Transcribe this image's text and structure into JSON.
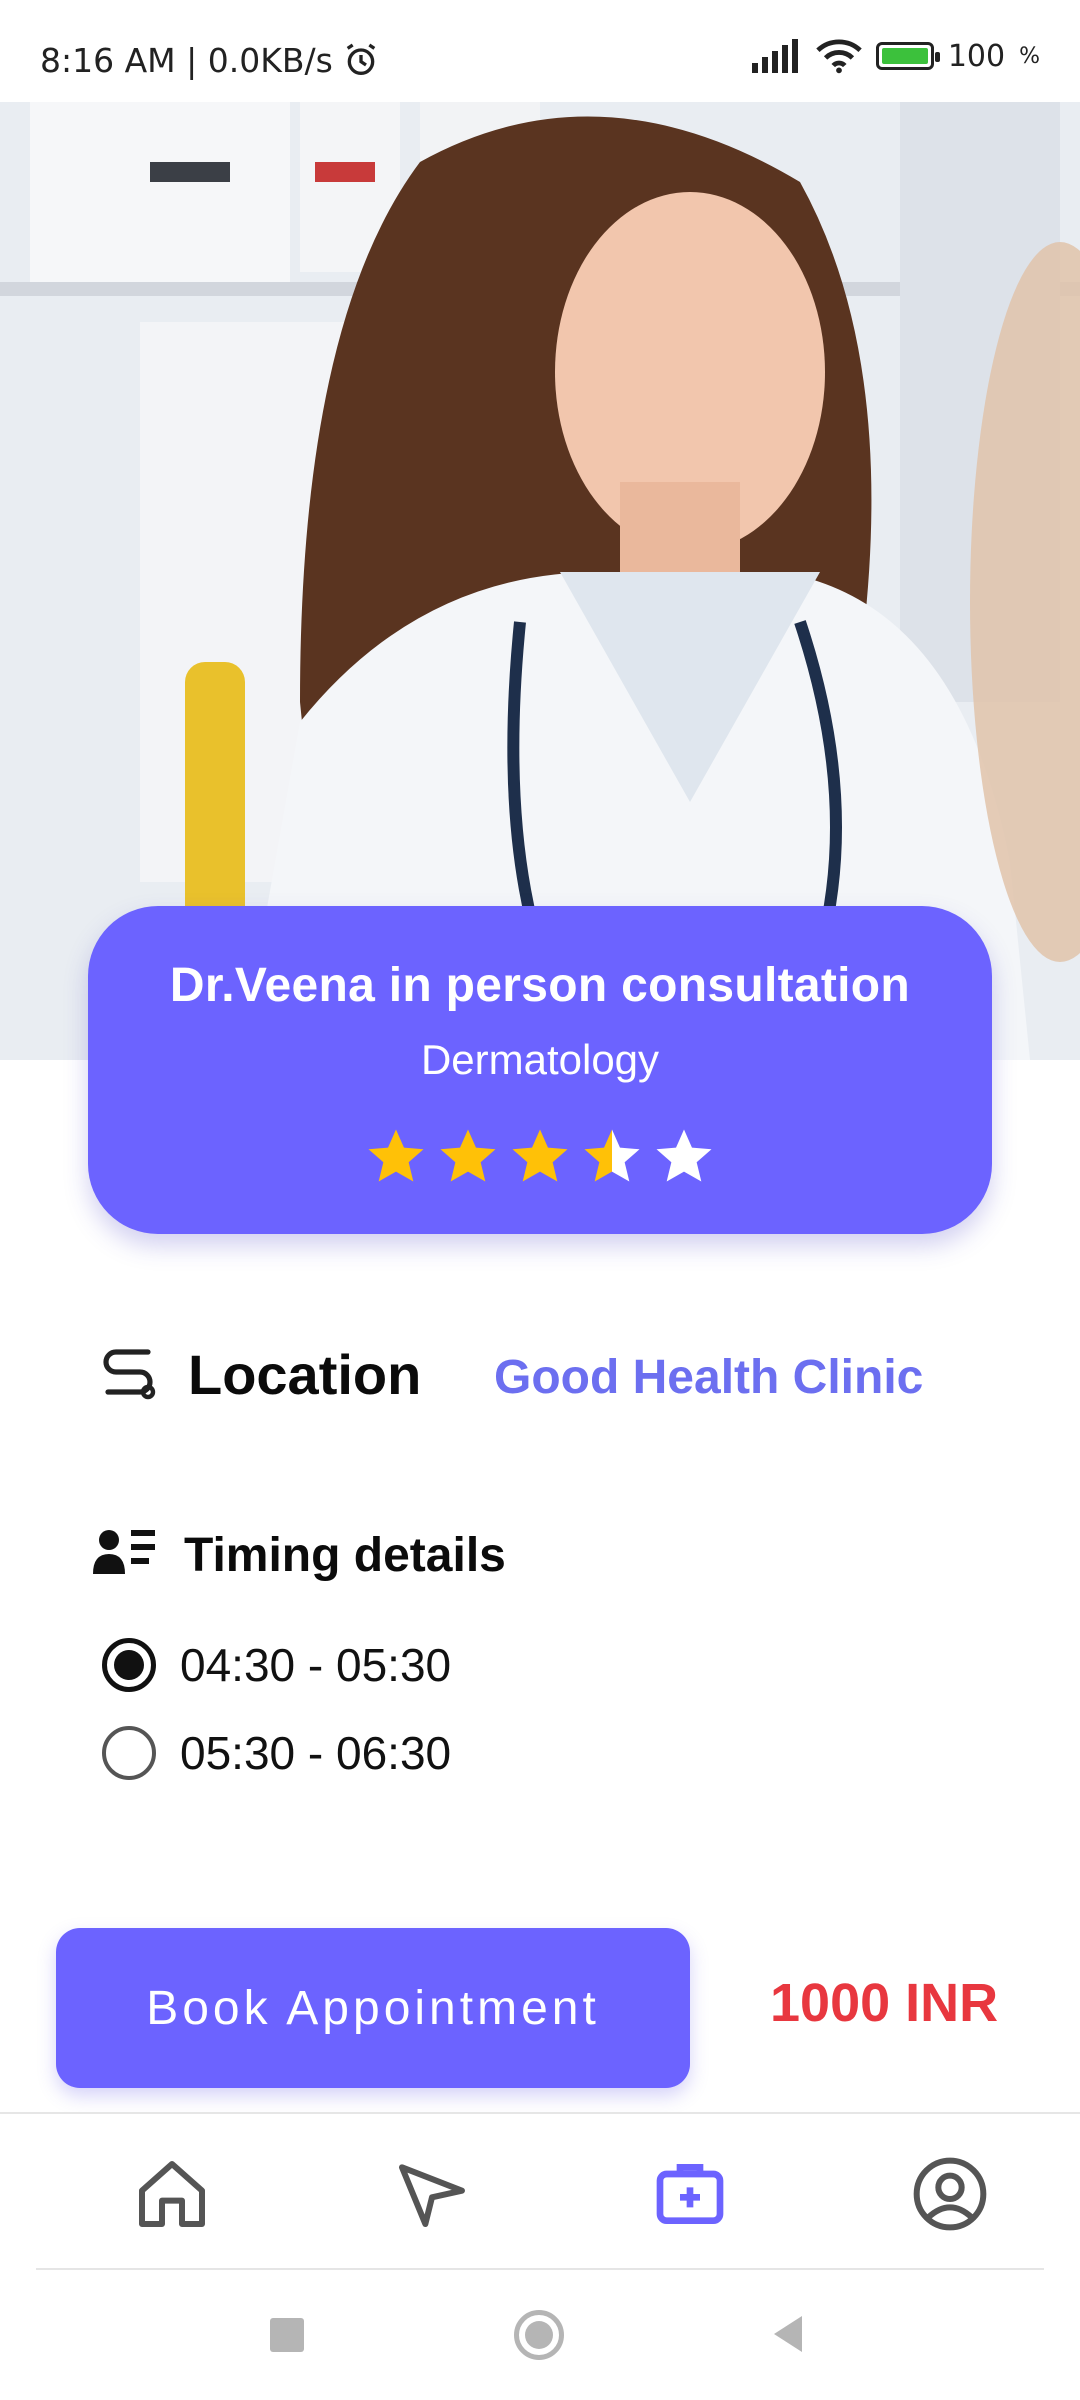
{
  "status_bar": {
    "time": "8:16 AM | 0.0KB/s",
    "battery": "100",
    "icons": [
      "alarm-icon",
      "signal-icon",
      "wifi-icon",
      "battery-charging-icon"
    ]
  },
  "doctor": {
    "name": "Dr.Veena in person consultation",
    "specialty": "Dermatology",
    "rating": 3.5,
    "rating_max": 5
  },
  "location": {
    "label": "Location",
    "value": "Good Health Clinic",
    "icon": "route-icon"
  },
  "timing": {
    "title": "Timing details",
    "icon": "timing-list-icon",
    "options": [
      {
        "label": "04:30 - 05:30",
        "selected": true
      },
      {
        "label": "05:30 - 06:30",
        "selected": false
      }
    ]
  },
  "booking": {
    "button_label": "Book Appointment",
    "price": "1000 INR"
  },
  "bottom_nav": {
    "items": [
      "home-icon",
      "send-icon",
      "medical-kit-icon",
      "profile-icon"
    ],
    "active": "medical-kit-icon"
  },
  "system_nav": [
    "recents-icon",
    "home-circle-icon",
    "back-icon"
  ],
  "colors": {
    "accent": "#6c63ff",
    "price": "#e8373f",
    "link": "#6c6ff0",
    "star": "#ffc107"
  }
}
